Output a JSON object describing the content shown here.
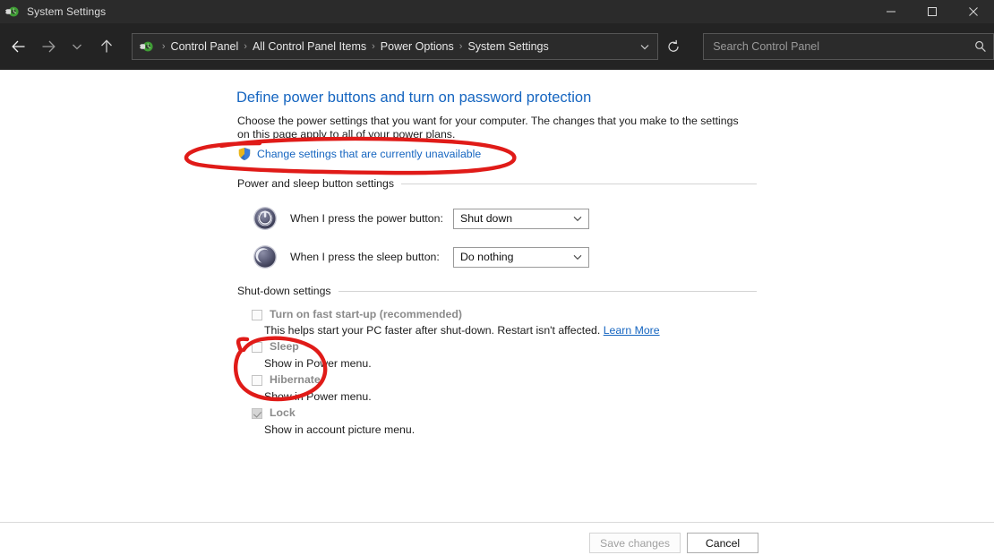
{
  "window": {
    "title": "System Settings",
    "app_icon": "power-options-icon",
    "controls": {
      "minimize": "minimize-icon",
      "maximize": "maximize-icon",
      "close": "close-icon"
    }
  },
  "nav": {
    "back": "back-arrow-icon",
    "forward": "forward-arrow-icon",
    "recent": "chevron-down-icon",
    "up": "up-arrow-icon",
    "refresh": "refresh-icon",
    "breadcrumbs": [
      "Control Panel",
      "All Control Panel Items",
      "Power Options",
      "System Settings"
    ],
    "separator": "›"
  },
  "search": {
    "placeholder": "Search Control Panel",
    "value": "",
    "icon": "search-icon"
  },
  "page": {
    "title": "Define power buttons and turn on password protection",
    "description": "Choose the power settings that you want for your computer. The changes that you make to the settings on this page apply to all of your power plans.",
    "uac_link": "Change settings that are currently unavailable",
    "uac_icon": "shield-icon"
  },
  "power_group": {
    "header": "Power and sleep button settings",
    "rows": [
      {
        "icon": "power-button-icon",
        "label": "When I press the power button:",
        "value": "Shut down"
      },
      {
        "icon": "sleep-button-icon",
        "label": "When I press the sleep button:",
        "value": "Do nothing"
      }
    ]
  },
  "shutdown_group": {
    "header": "Shut-down settings",
    "options": [
      {
        "label": "Turn on fast start-up (recommended)",
        "checked": false,
        "enabled": false,
        "description": "This helps start your PC faster after shut-down. Restart isn't affected.",
        "link": "Learn More"
      },
      {
        "label": "Sleep",
        "checked": false,
        "enabled": false,
        "description": "Show in Power menu.",
        "link": ""
      },
      {
        "label": "Hibernate",
        "checked": false,
        "enabled": false,
        "description": "Show in Power menu.",
        "link": ""
      },
      {
        "label": "Lock",
        "checked": true,
        "enabled": false,
        "description": "Show in account picture menu.",
        "link": ""
      }
    ]
  },
  "footer": {
    "save_label": "Save changes",
    "save_enabled": false,
    "cancel_label": "Cancel"
  },
  "annotations": {
    "color": "#e01b18",
    "marks": [
      {
        "name": "ellipse-around-uac-link",
        "shape": "ellipse"
      },
      {
        "name": "ellipse-around-sleep-hibernate",
        "shape": "ellipse"
      }
    ]
  },
  "colors": {
    "titlebar_bg": "#2b2b2b",
    "navbar_bg": "#232323",
    "content_bg": "#ffffff",
    "link_blue": "#1565c0",
    "ink_red": "#e01b18",
    "disabled_text": "#8b8b8b"
  }
}
